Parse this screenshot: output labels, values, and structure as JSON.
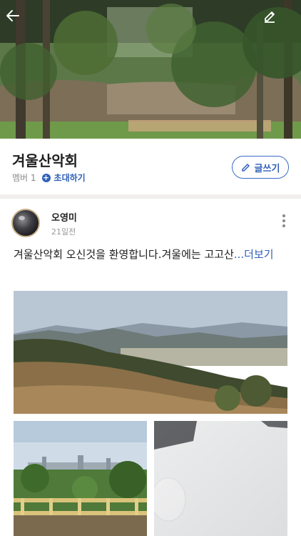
{
  "group": {
    "name": "겨울산악회",
    "member_count": "멤버 1",
    "invite_label": "초대하기",
    "write_label": "글쓰기"
  },
  "post": {
    "author": "오영미",
    "date": "21일전",
    "text": "겨울산악회 오신것을 환영합니다.겨울에는 고고산",
    "more_label": "...더보기"
  },
  "icons": {
    "back": "arrow-left-icon",
    "edit": "pencil-icon",
    "more": "more-vertical-icon",
    "write": "pencil-icon",
    "invite": "plus-circle-icon"
  },
  "colors": {
    "accent": "#2f5fb9",
    "divider": "#f2eeee"
  }
}
